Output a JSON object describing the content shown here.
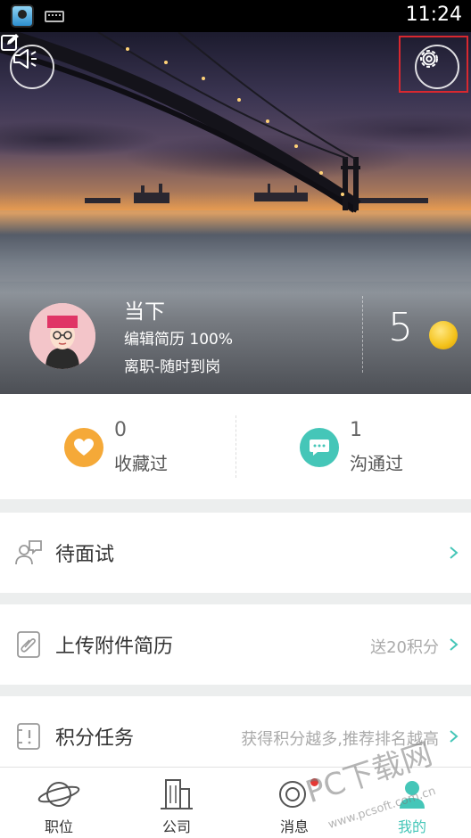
{
  "status_bar": {
    "time": "11:24"
  },
  "profile": {
    "name": "当下",
    "resume_progress": "编辑简历 100%",
    "job_status": "离职-随时到岗",
    "points": "5"
  },
  "stats": {
    "favorites": {
      "count": "0",
      "label": "收藏过"
    },
    "contacted": {
      "count": "1",
      "label": "沟通过"
    }
  },
  "menu": [
    {
      "label": "待面试",
      "hint": ""
    },
    {
      "label": "上传附件简历",
      "hint": "送20积分"
    },
    {
      "label": "积分任务",
      "hint": "获得积分越多,推荐排名越高"
    }
  ],
  "tabs": [
    {
      "label": "职位"
    },
    {
      "label": "公司"
    },
    {
      "label": "消息"
    },
    {
      "label": "我的"
    }
  ],
  "watermark": {
    "text": "PC下载网",
    "url": "www.pcsoft.com.cn"
  },
  "colors": {
    "accent_teal": "#45c6b8",
    "favorite_orange": "#f5a938",
    "highlight_red": "#d9282f"
  }
}
